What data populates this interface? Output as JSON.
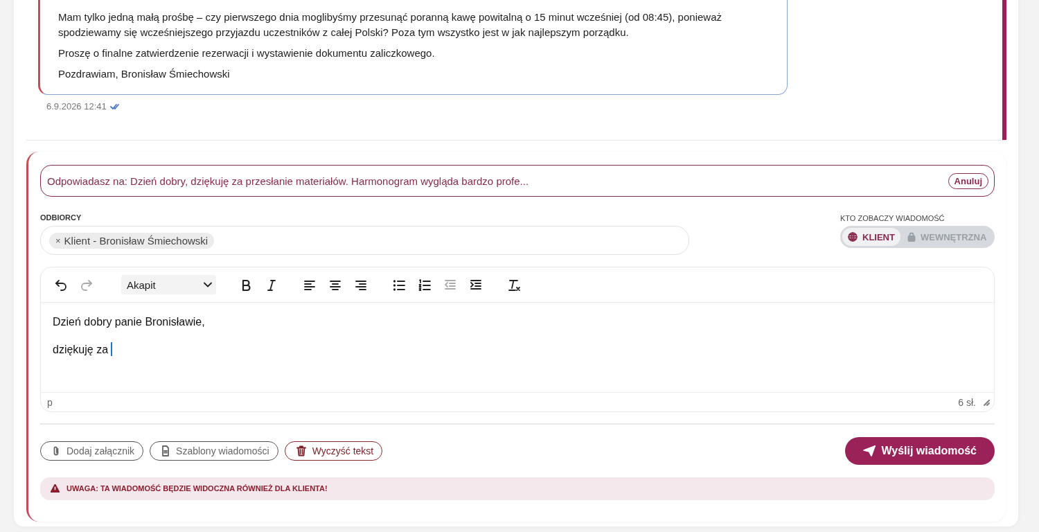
{
  "message": {
    "paragraphs": [
      "Mam tylko jedną małą prośbę – czy pierwszego dnia moglibyśmy przesunąć poranną kawę powitalną o 15 minut wcześniej (od 08:45), ponieważ spodziewamy się wcześniejszego przyjazdu uczestników z całej Polski? Poza tym wszystko jest w jak najlepszym porządku.",
      "Proszę o finalne zatwierdzenie rezerwacji i wystawienie dokumentu zaliczkowego.",
      "Pozdrawiam, Bronisław Śmiechowski"
    ],
    "timestamp": "6.9.2026 12:41"
  },
  "reply_banner": {
    "text": "Odpowiadasz na: Dzień dobry, dziękuję za przesłanie materiałów. Harmonogram wygląda bardzo profe...",
    "cancel": "Anuluj"
  },
  "recipients": {
    "label": "ODBIORCY",
    "chips": [
      {
        "remove": "×",
        "label": "Klient - Bronisław Śmiechowski"
      }
    ]
  },
  "visibility": {
    "label": "KTO ZOBACZY WIADOMOŚĆ",
    "options": [
      {
        "kind": "globe",
        "label": "KLIENT",
        "selected": true
      },
      {
        "kind": "lock",
        "label": "WEWNĘTRZNA",
        "selected": false
      }
    ]
  },
  "editor": {
    "toolbar": [
      {
        "kind": "undo",
        "disabled": false
      },
      {
        "kind": "redo",
        "disabled": true
      },
      {
        "kind": "format",
        "value": "Akapit",
        "disabled": false
      },
      {
        "kind": "bold",
        "disabled": false
      },
      {
        "kind": "italic",
        "disabled": false
      },
      {
        "kind": "align-left",
        "disabled": false
      },
      {
        "kind": "align-center",
        "disabled": false
      },
      {
        "kind": "align-right",
        "disabled": false
      },
      {
        "kind": "bullet-list",
        "disabled": false
      },
      {
        "kind": "number-list",
        "disabled": false
      },
      {
        "kind": "outdent",
        "disabled": true
      },
      {
        "kind": "indent",
        "disabled": false
      },
      {
        "kind": "clear-format",
        "disabled": false
      }
    ],
    "content": [
      "Dzień dobry panie Bronisławie,",
      "dziękuję za"
    ],
    "path": "p",
    "word_count": "6 sł."
  },
  "actions": [
    {
      "kind": "attach",
      "label": "Dodaj załącznik"
    },
    {
      "kind": "template",
      "label": "Szablony wiadomości"
    },
    {
      "kind": "clear",
      "label": "Wyczyść tekst"
    },
    {
      "kind": "send",
      "label": "Wyślij wiadomość"
    }
  ],
  "warning": "UWAGA: TA WIADOMOŚĆ BĘDZIE WIDOCZNA RÓWNIEŻ DLA KLIENTA!"
}
